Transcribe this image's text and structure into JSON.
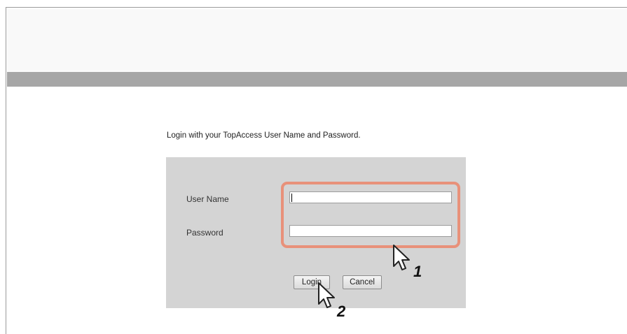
{
  "instruction": "Login with your TopAccess User Name and Password.",
  "form": {
    "user_name_label": "User Name",
    "password_label": "Password",
    "user_name_value": "",
    "password_value": "",
    "login_label": "Login",
    "cancel_label": "Cancel"
  },
  "callouts": {
    "step1": "1",
    "step2": "2",
    "highlight_color": "#e8917a"
  },
  "colors": {
    "header_bar": "#a6a6a6",
    "panel": "#d4d4d4"
  }
}
